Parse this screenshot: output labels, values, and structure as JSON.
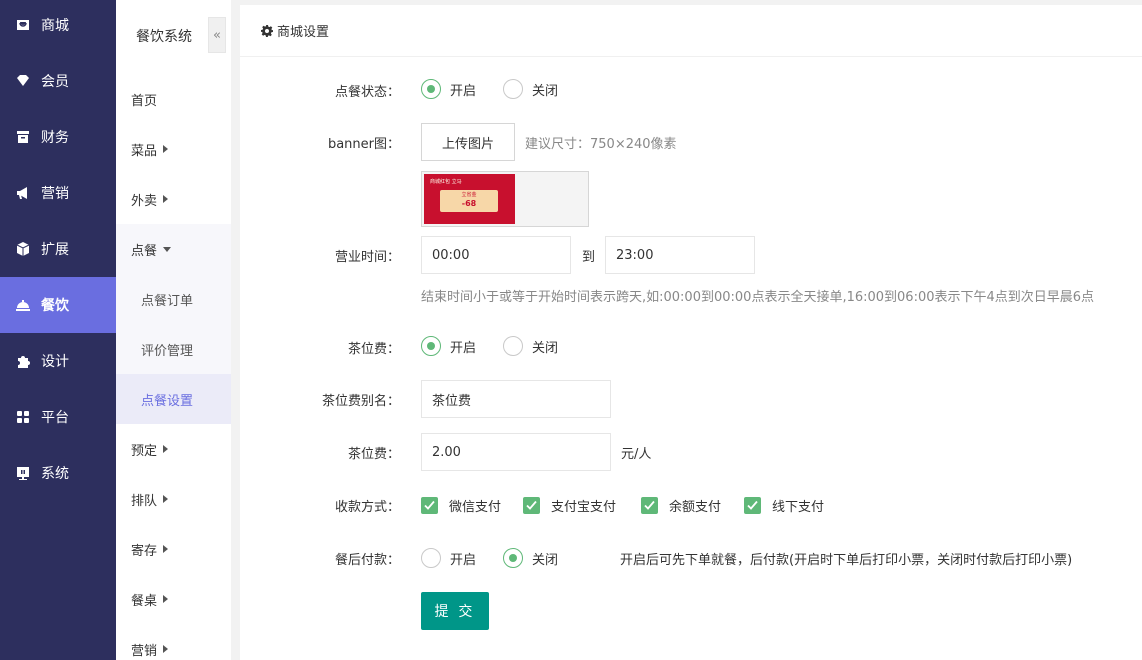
{
  "sidebar": {
    "items": [
      {
        "label": "商城",
        "icon": "shop-icon"
      },
      {
        "label": "会员",
        "icon": "member-icon"
      },
      {
        "label": "财务",
        "icon": "finance-icon"
      },
      {
        "label": "营销",
        "icon": "marketing-icon"
      },
      {
        "label": "扩展",
        "icon": "extension-icon"
      },
      {
        "label": "餐饮",
        "icon": "restaurant-icon",
        "active": true
      },
      {
        "label": "设计",
        "icon": "design-icon"
      },
      {
        "label": "平台",
        "icon": "platform-icon"
      },
      {
        "label": "系统",
        "icon": "system-icon"
      }
    ]
  },
  "subnav": {
    "title": "餐饮系统",
    "collapse_glyph": "«",
    "items": [
      {
        "label": "首页"
      },
      {
        "label": "菜品"
      },
      {
        "label": "外卖"
      },
      {
        "label": "点餐"
      },
      {
        "label": "预定"
      },
      {
        "label": "排队"
      },
      {
        "label": "寄存"
      },
      {
        "label": "餐桌"
      },
      {
        "label": "营销"
      }
    ],
    "subitems": [
      {
        "label": "点餐订单"
      },
      {
        "label": "评价管理"
      },
      {
        "label": "点餐设置",
        "active": true
      }
    ]
  },
  "panel": {
    "title": "商城设置"
  },
  "form": {
    "order_status": {
      "label": "点餐状态：",
      "on": "开启",
      "off": "关闭",
      "selected": "开启"
    },
    "banner": {
      "label": "banner图：",
      "upload_button": "上传图片",
      "hint": "建议尺寸：750×240像素",
      "preview_title": "商城红包 立马",
      "preview_sub": "立省金",
      "preview_amount": "-68"
    },
    "business_hours": {
      "label": "营业时间：",
      "start": "00:00",
      "to": "到",
      "end": "23:00",
      "hint": "结束时间小于或等于开始时间表示跨天,如:00:00到00:00点表示全天接单,16:00到06:00表示下午4点到次日早晨6点"
    },
    "tea_fee": {
      "label": "茶位费：",
      "on": "开启",
      "off": "关闭",
      "selected": "开启"
    },
    "tea_alias": {
      "label": "茶位费别名：",
      "value": "茶位费"
    },
    "tea_price": {
      "label": "茶位费：",
      "value": "2.00",
      "unit": "元/人"
    },
    "payment": {
      "label": "收款方式：",
      "options": [
        {
          "label": "微信支付",
          "checked": true
        },
        {
          "label": "支付宝支付",
          "checked": true
        },
        {
          "label": "余额支付",
          "checked": true
        },
        {
          "label": "线下支付",
          "checked": true
        }
      ]
    },
    "pay_after": {
      "label": "餐后付款：",
      "on": "开启",
      "off": "关闭",
      "selected": "关闭",
      "hint": "开启后可先下单就餐，后付款(开启时下单后打印小票，关闭时付款后打印小票)"
    },
    "submit": "提 交"
  },
  "colors": {
    "sidebar_bg": "#2d2f5e",
    "sidebar_active": "#6a6ee0",
    "check_green": "#5fb878",
    "submit_teal": "#009688"
  }
}
